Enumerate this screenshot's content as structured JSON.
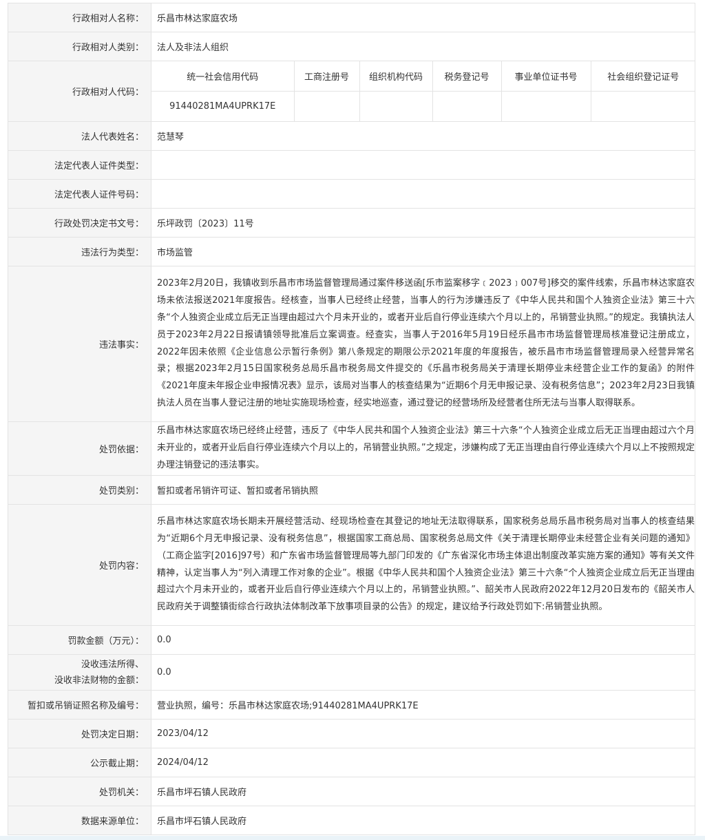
{
  "rows": {
    "name": {
      "label": "行政相对人名称：",
      "value": "乐昌市林达家庭农场"
    },
    "type": {
      "label": "行政相对人类别：",
      "value": "法人及非法人组织"
    },
    "code": {
      "label": "行政相对人代码：",
      "headers": [
        "统一社会信用代码",
        "工商注册号",
        "组织机构代码",
        "税务登记号",
        "事业单位证书号",
        "社会组织登记证号"
      ],
      "values": [
        "91440281MA4UPRK17E",
        "",
        "",
        "",
        "",
        ""
      ]
    },
    "legal_rep": {
      "label": "法人代表姓名：",
      "value": "范慧琴"
    },
    "id_type": {
      "label": "法定代表人证件类型：",
      "value": ""
    },
    "id_number": {
      "label": "法定代表人证件号码：",
      "value": ""
    },
    "doc_no": {
      "label": "行政处罚决定书文号：",
      "value": "乐坪政罚〔2023〕11号"
    },
    "violation_type": {
      "label": "违法行为类型：",
      "value": "市场监管"
    },
    "facts": {
      "label": "违法事实：",
      "value": "2023年2月20日，我镇收到乐昌市市场监督管理局通过案件移送函[乐市监案移字﹝2023﹞007号]移交的案件线索，乐昌市林达家庭农场未依法报送2021年度报告。经核查，当事人已经终止经营，当事人的行为涉嫌违反了《中华人民共和国个人独资企业法》第三十六条“个人独资企业成立后无正当理由超过六个月未开业的，或者开业后自行停业连续六个月以上的，吊销营业执照。”的规定。我镇执法人员于2023年2月22日报请镇领导批准后立案调查。经查实，当事人于2016年5月19日经乐昌市市场监督管理局核准登记注册成立，2022年因未依照《企业信息公示暂行条例》第八条规定的期限公示2021年度的年度报告，被乐昌市市场监督管理局录入经营异常名录；根据2023年2月15日国家税务总局乐昌市税务局文件提交的《乐昌市税务局关于清理长期停业未经营企业工作的复函》的附件《2021年度未年报企业申报情况表》显示，该局对当事人的核查结果为“近期6个月无申报记录、没有税务信息”；2023年2月23日我镇执法人员在当事人登记注册的地址实施现场检查，经实地巡查，通过登记的经营场所及经营者住所无法与当事人取得联系。"
    },
    "basis": {
      "label": "处罚依据：",
      "value": "乐昌市林达家庭农场已经终止经营，违反了《中华人民共和国个人独资企业法》第三十六条“个人独资企业成立后无正当理由超过六个月未开业的，或者开业后自行停业连续六个月以上的，吊销营业执照。”之规定，涉嫌构成了无正当理由自行停业连续六个月以上不按照规定办理注销登记的违法事实。"
    },
    "penalty_type": {
      "label": "处罚类别：",
      "value": "暂扣或者吊销许可证、暂扣或者吊销执照"
    },
    "content": {
      "label": "处罚内容：",
      "value": "乐昌市林达家庭农场长期未开展经营活动、经现场检查在其登记的地址无法取得联系，国家税务总局乐昌市税务局对当事人的核查结果为“近期6个月无申报记录、没有税务信息”，根据国家工商总局、国家税务总局文件《关于清理长期停业未经营企业有关问题的通知》（工商企监字[2016]97号）和广东省市场监督管理局等九部门印发的《广东省深化市场主体退出制度改革实施方案的通知》等有关文件精神，认定当事人为“列入清理工作对象的企业”。根据《中华人民共和国个人独资企业法》第三十六条“个人独资企业成立后无正当理由超过六个月未开业的，或者开业后自行停业连续六个月以上的，吊销营业执照。”、韶关市人民政府2022年12月20日发布的《韶关市人民政府关于调整镇街综合行政执法体制改革下放事项目录的公告》的规定，建议给予行政处罚如下:吊销营业执照。"
    },
    "fine": {
      "label": "罚款金额（万元）：",
      "value": "0.0"
    },
    "confiscation": {
      "label_line1": "没收违法所得、",
      "label_line2": "没收非法财物的金额：",
      "value": "0.0"
    },
    "license": {
      "label": "暂扣或吊销证照名称及编号：",
      "value": "营业执照，编号：乐昌市林达家庭农场;91440281MA4UPRK17E"
    },
    "decision_date": {
      "label": "处罚决定日期：",
      "value": "2023/04/12"
    },
    "publicity_deadline": {
      "label": "公示截止期：",
      "value": "2024/04/12"
    },
    "authority": {
      "label": "处罚机关：",
      "value": "乐昌市坪石镇人民政府"
    },
    "source": {
      "label": "数据来源单位：",
      "value": "乐昌市坪石镇人民政府"
    }
  }
}
